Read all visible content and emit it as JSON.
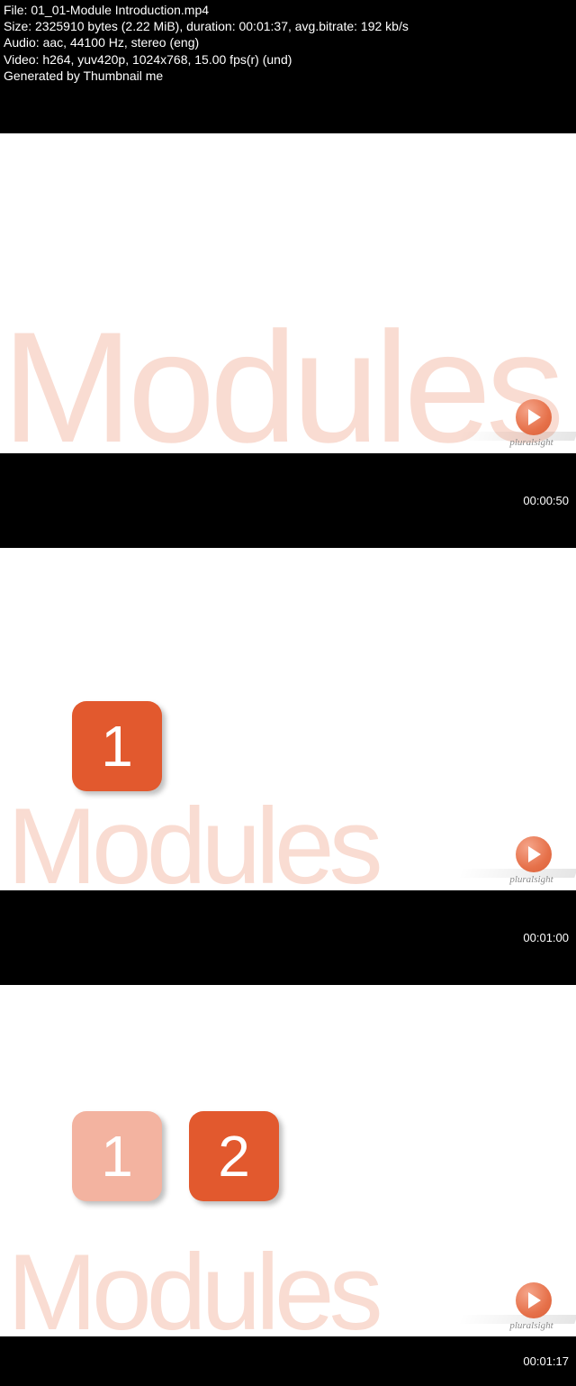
{
  "header": {
    "file_label": "File:",
    "file_name": "01_01-Module Introduction.mp4",
    "size_label": "Size:",
    "size_value": "2325910 bytes (2.22 MiB), duration: 00:01:37, avg.bitrate: 192 kb/s",
    "audio_label": "Audio:",
    "audio_value": "aac, 44100 Hz, stereo (eng)",
    "video_label": "Video:",
    "video_value": "h264, yuv420p, 1024x768, 15.00 fps(r) (und)",
    "generated": "Generated by Thumbnail me"
  },
  "watermark": "Modules",
  "brand": "pluralsight",
  "tiles": {
    "one": "1",
    "two": "2"
  },
  "timestamps": {
    "t1": "00:00:50",
    "t2": "00:01:00",
    "t3": "00:01:17"
  }
}
